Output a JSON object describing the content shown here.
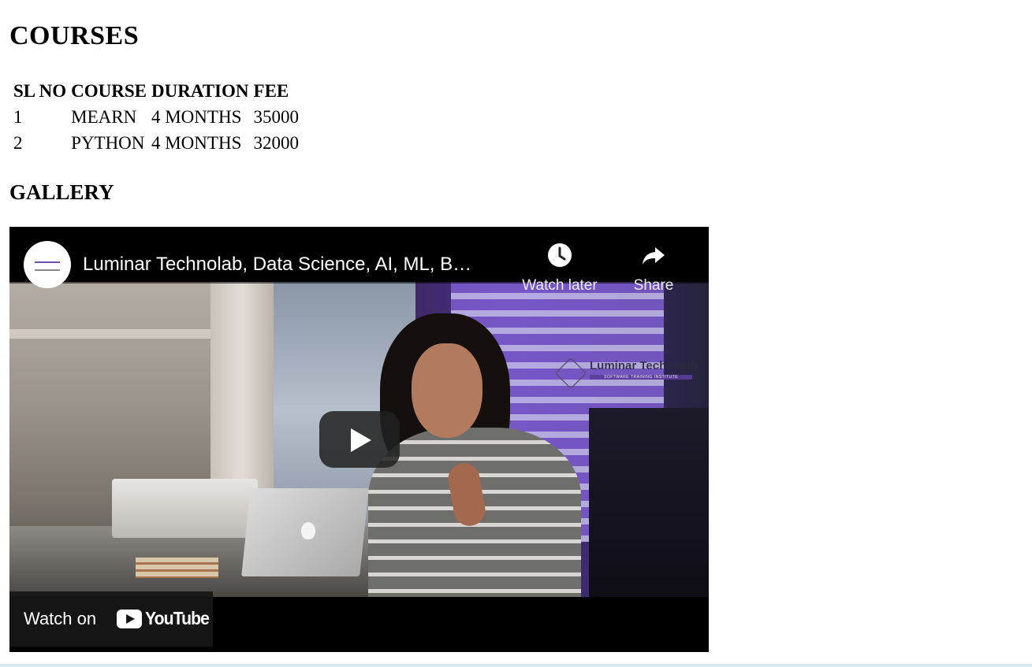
{
  "courses": {
    "heading": "COURSES",
    "columns": [
      "SL NO",
      "COURSE",
      "DURATION",
      "FEE"
    ],
    "rows": [
      [
        "1",
        "MEARN",
        "4 MONTHS",
        "35000"
      ],
      [
        "2",
        "PYTHON",
        "4 MONTHS",
        "32000"
      ]
    ]
  },
  "gallery": {
    "heading": "GALLERY",
    "video": {
      "title": "Luminar Technolab, Data Science, AI, ML, B…",
      "watch_later_label": "Watch later",
      "share_label": "Share",
      "watch_on_label": "Watch on",
      "platform_label": "YouTube",
      "watermark_name": "Luminar Technolab",
      "watermark_tagline": "SOFTWARE TRAINING INSTITUTE"
    }
  },
  "colors": {
    "video_bg": "#000000",
    "watermark_accent": "#5a3d9c"
  },
  "icons": [
    "clock-icon",
    "share-arrow-icon",
    "play-icon",
    "youtube-logo-icon",
    "channel-avatar"
  ]
}
